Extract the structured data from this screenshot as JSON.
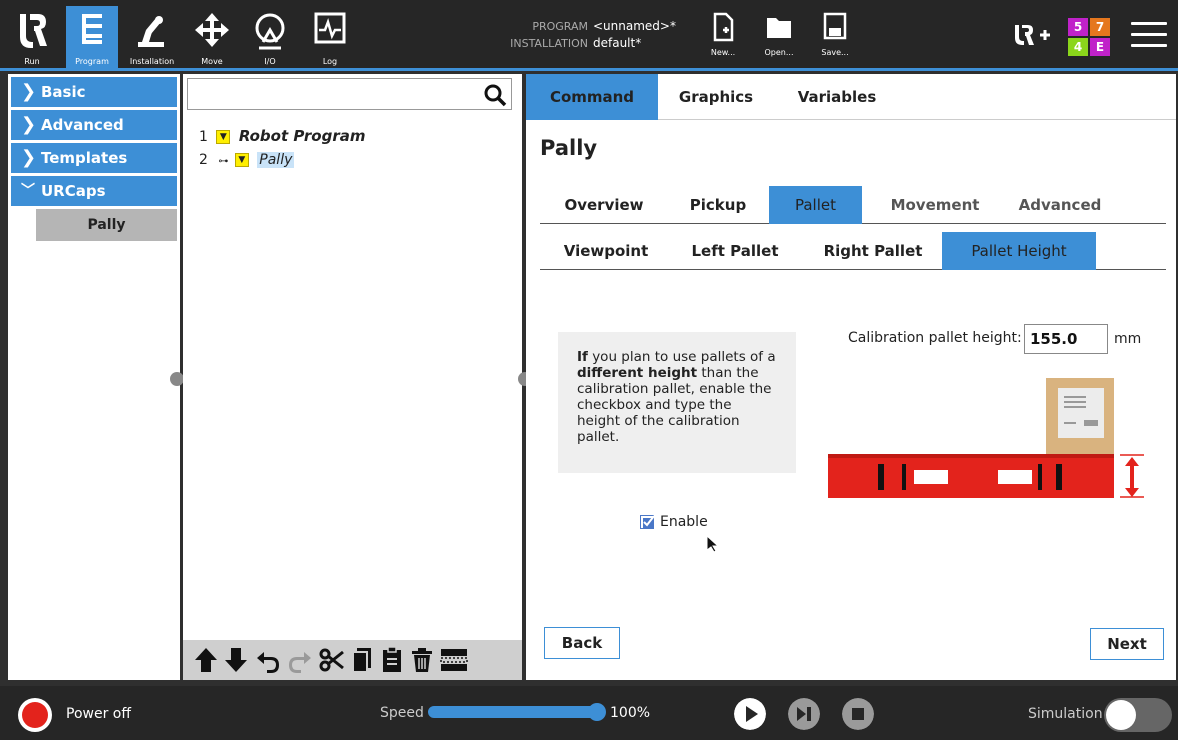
{
  "header": {
    "nav": [
      {
        "label": "Run",
        "icon": "ur-logo-icon"
      },
      {
        "label": "Program",
        "icon": "program-tree-icon",
        "active": true
      },
      {
        "label": "Installation",
        "icon": "robot-arm-icon"
      },
      {
        "label": "Move",
        "icon": "move-arrows-icon"
      },
      {
        "label": "I/O",
        "icon": "io-icon"
      },
      {
        "label": "Log",
        "icon": "log-pulse-icon"
      }
    ],
    "program_key": "PROGRAM",
    "program_value": "<unnamed>*",
    "installation_key": "INSTALLATION",
    "installation_value": "default*",
    "file_buttons": [
      {
        "label": "New...",
        "icon": "new-file-icon"
      },
      {
        "label": "Open...",
        "icon": "open-folder-icon"
      },
      {
        "label": "Save...",
        "icon": "save-disk-icon"
      }
    ],
    "urplus": "UR+",
    "badges": [
      "5",
      "7",
      "4",
      "E"
    ],
    "badge_colors": [
      "#c022c9",
      "#e5771e",
      "#8bd61b",
      "#c022c9"
    ]
  },
  "sidebar": {
    "items": [
      {
        "label": "Basic",
        "expanded": false
      },
      {
        "label": "Advanced",
        "expanded": false
      },
      {
        "label": "Templates",
        "expanded": false
      },
      {
        "label": "URCaps",
        "expanded": true
      }
    ],
    "sub_item": "Pally"
  },
  "tree": {
    "search_placeholder": "",
    "lines": [
      {
        "num": "1",
        "label": "Robot Program"
      },
      {
        "num": "2",
        "label": "Pally"
      }
    ]
  },
  "right": {
    "top_tabs": [
      "Command",
      "Graphics",
      "Variables"
    ],
    "title": "Pally",
    "tabs1": [
      "Overview",
      "Pickup",
      "Pallet",
      "Movement",
      "Advanced"
    ],
    "tabs2": [
      "Viewpoint",
      "Left Pallet",
      "Right Pallet",
      "Pallet Height"
    ],
    "info": {
      "p1": "If",
      "p2": " you plan to use pallets of a ",
      "p3": "different height",
      "p4": " than the calibration pallet, enable the checkbox and type the height of the calibration pallet."
    },
    "height_label": "Calibration pallet height:",
    "height_value": "155.0",
    "height_unit": "mm",
    "enable_label": "Enable",
    "enable_checked": true,
    "back_label": "Back",
    "next_label": "Next"
  },
  "footer": {
    "power_label": "Power off",
    "speed_label": "Speed",
    "speed_value": "100%",
    "speed_fraction": 1.0,
    "simulation_label": "Simulation",
    "simulation_on": false
  },
  "colors": {
    "accent": "#3d8fd6",
    "header_bg": "#262626",
    "pallet_red": "#e3231c",
    "tree_triangle": "#ffef00"
  }
}
